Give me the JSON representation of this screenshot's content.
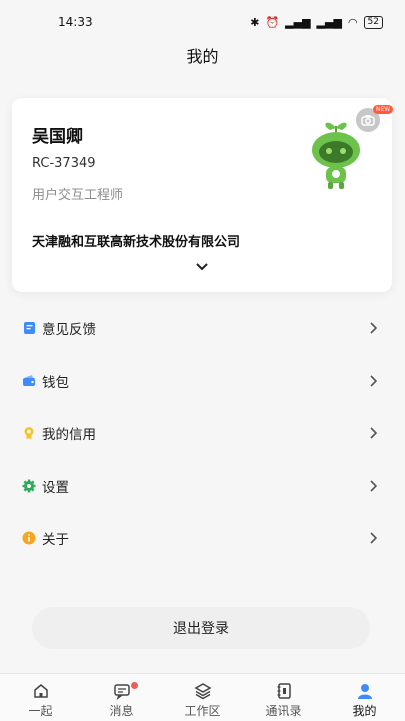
{
  "status_bar": {
    "time": "14:33",
    "battery": "52"
  },
  "nav": {
    "title": "我的"
  },
  "profile": {
    "name": "吴国卿",
    "user_id": "RC-37349",
    "role": "用户交互工程师",
    "company": "天津融和互联高新技术股份有限公司",
    "badge": "NEW"
  },
  "menu": {
    "items": [
      {
        "label": "意见反馈",
        "icon": "feedback-icon",
        "color": "#3d8bff"
      },
      {
        "label": "钱包",
        "icon": "wallet-icon",
        "color": "#3d8bff"
      },
      {
        "label": "我的信用",
        "icon": "credit-icon",
        "color": "#f2c230"
      },
      {
        "label": "设置",
        "icon": "gear-icon",
        "color": "#2eaa5a"
      },
      {
        "label": "关于",
        "icon": "info-icon",
        "color": "#f5a623"
      }
    ]
  },
  "logout": {
    "label": "退出登录"
  },
  "tabs": [
    {
      "label": "一起",
      "icon": "home-icon"
    },
    {
      "label": "消息",
      "icon": "message-icon",
      "has_dot": true
    },
    {
      "label": "工作区",
      "icon": "layers-icon"
    },
    {
      "label": "通讯录",
      "icon": "contacts-icon"
    },
    {
      "label": "我的",
      "icon": "profile-icon",
      "active": true
    }
  ],
  "colors": {
    "accent": "#3d8bff",
    "mascot": "#6cc24a",
    "notification": "#f05a5a"
  }
}
